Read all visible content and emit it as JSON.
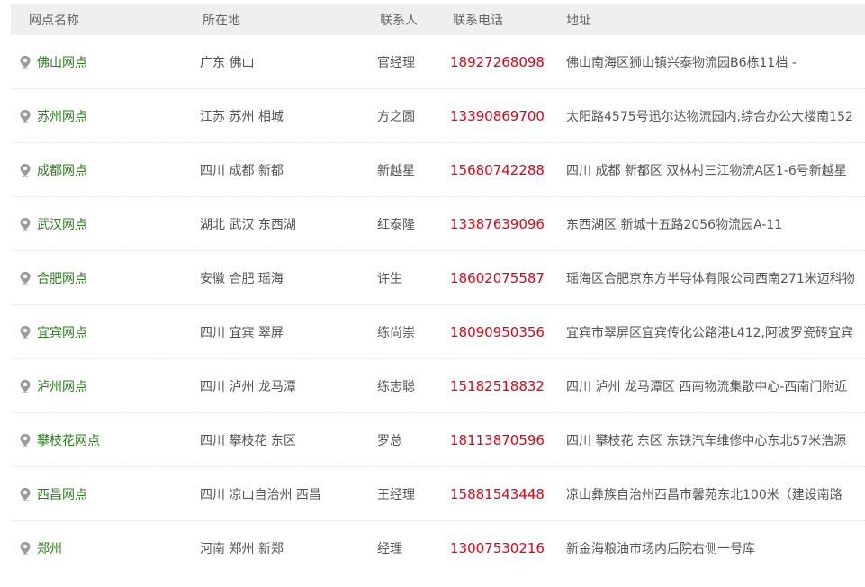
{
  "header": {
    "name": "网点名称",
    "location": "所在地",
    "contact": "联系人",
    "phone": "联系电话",
    "address": "地址"
  },
  "colors": {
    "branch_text": "#2e7d1f",
    "phone_text": "#e60012",
    "header_bg": "#efefef"
  },
  "rows": [
    {
      "name": "佛山网点",
      "location": "广东 佛山",
      "contact": "官经理",
      "phone": "18927268098",
      "address": "佛山南海区狮山镇兴泰物流园B6栋11档 -"
    },
    {
      "name": "苏州网点",
      "location": "江苏 苏州 相城",
      "contact": "方之圆",
      "phone": "13390869700",
      "address": "太阳路4575号迅尔达物流园内,综合办公大楼南152"
    },
    {
      "name": "成都网点",
      "location": "四川 成都 新都",
      "contact": "新越星",
      "phone": "15680742288",
      "address": "四川 成都 新都区 双林村三江物流A区1-6号新越星"
    },
    {
      "name": "武汉网点",
      "location": "湖北 武汉 东西湖",
      "contact": "红泰隆",
      "phone": "13387639096",
      "address": "东西湖区 新城十五路2056物流园A-11"
    },
    {
      "name": "合肥网点",
      "location": "安徽 合肥 瑶海",
      "contact": "许生",
      "phone": "18602075587",
      "address": "瑶海区合肥京东方半导体有限公司西南271米迈科物"
    },
    {
      "name": "宜宾网点",
      "location": "四川 宜宾 翠屏",
      "contact": "练尚崇",
      "phone": "18090950356",
      "address": "宜宾市翠屏区宜宾传化公路港L412,阿波罗瓷砖宜宾"
    },
    {
      "name": "泸州网点",
      "location": "四川 泸州 龙马潭",
      "contact": "练志聪",
      "phone": "15182518832",
      "address": "四川 泸州 龙马潭区 西南物流集散中心-西南门附近"
    },
    {
      "name": "攀枝花网点",
      "location": "四川 攀枝花 东区",
      "contact": "罗总",
      "phone": "18113870596",
      "address": "四川 攀枝花 东区 东铁汽车维修中心东北57米浩源"
    },
    {
      "name": "西昌网点",
      "location": "四川 凉山自治州 西昌",
      "contact": "王经理",
      "phone": "15881543448",
      "address": "凉山彝族自治州西昌市馨苑东北100米（建设南路"
    },
    {
      "name": "郑州",
      "location": "河南 郑州 新郑",
      "contact": "经理",
      "phone": "13007530216",
      "address": "新金海粮油市场内后院右侧一号库"
    }
  ]
}
